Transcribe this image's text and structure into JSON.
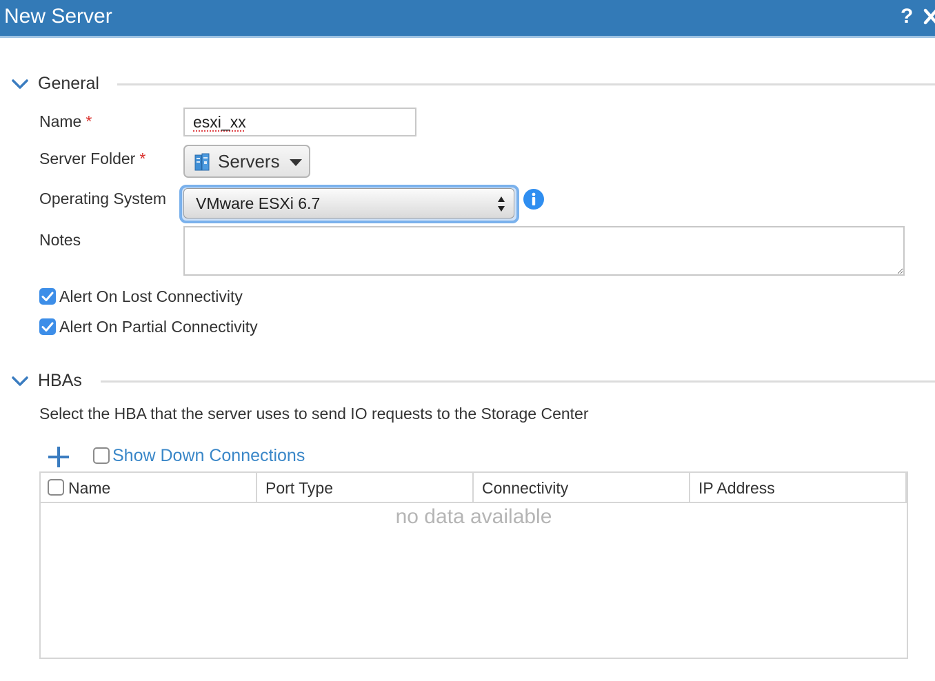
{
  "dialog": {
    "title": "New Server",
    "help_label": "?"
  },
  "general": {
    "title": "General",
    "name_label": "Name",
    "required_mark": "*",
    "name_value": "esxi_xx",
    "server_folder_label": "Server Folder",
    "server_folder_value": "Servers",
    "os_label": "Operating System",
    "os_value": "VMware ESXi 6.7",
    "notes_label": "Notes",
    "notes_value": "",
    "alert_lost_label": "Alert On Lost Connectivity",
    "alert_lost_checked": true,
    "alert_partial_label": "Alert On Partial Connectivity",
    "alert_partial_checked": true
  },
  "hbas": {
    "title": "HBAs",
    "description": "Select the HBA that the server uses to send IO requests to the Storage Center",
    "show_down_label": "Show Down Connections",
    "show_down_checked": false,
    "columns": [
      "Name",
      "Port Type",
      "Connectivity",
      "IP Address"
    ],
    "empty_message": "no data available"
  },
  "colors": {
    "titlebar": "#337ab7",
    "accent": "#3d8ee8",
    "link": "#3a87c8",
    "required": "#d9302c"
  },
  "icons": {
    "close": "close-icon",
    "help": "help-icon",
    "chevron": "chevron-down-icon",
    "folder": "server-folder-icon",
    "info": "info-icon",
    "add": "plus-icon",
    "check": "checkmark-icon"
  }
}
